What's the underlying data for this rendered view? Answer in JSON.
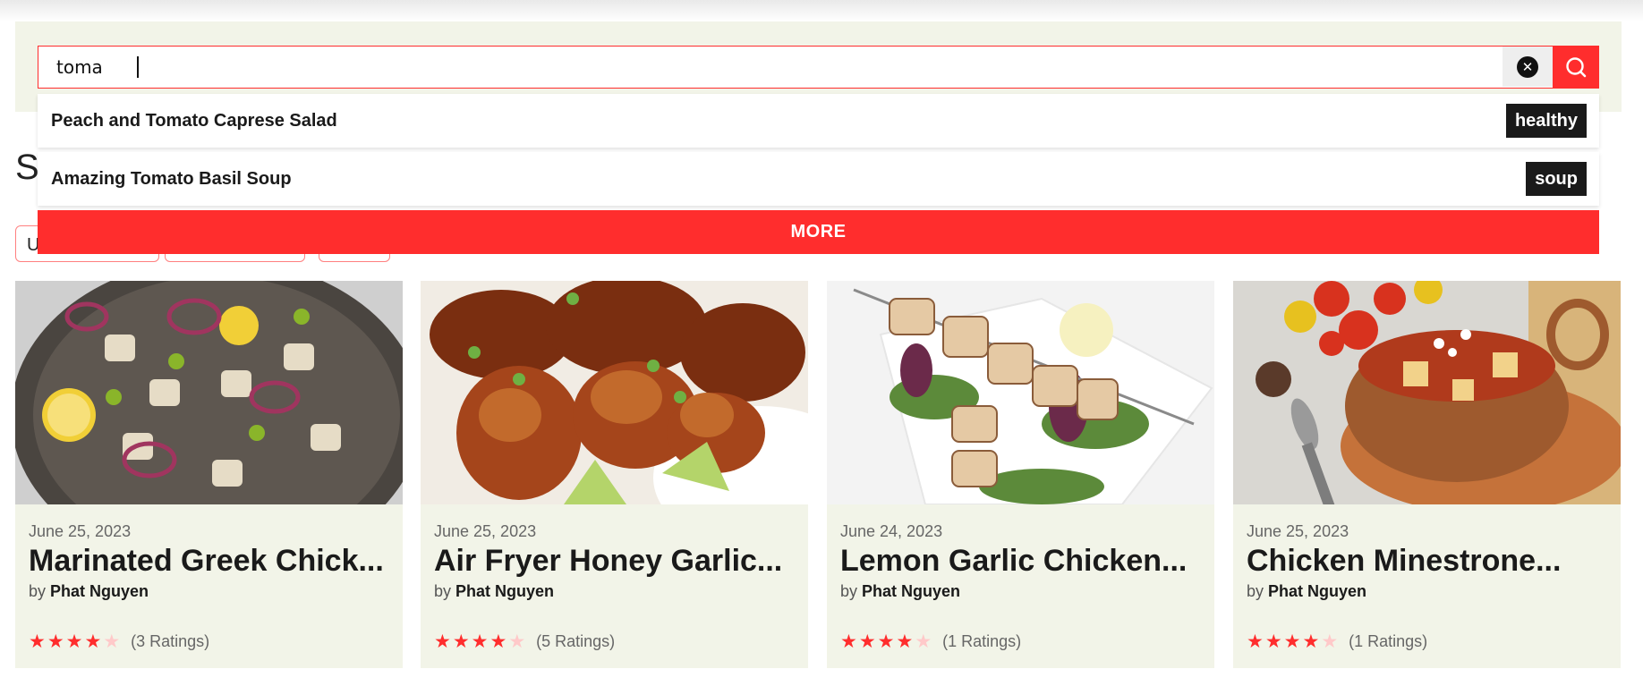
{
  "search": {
    "value": "toma",
    "clear_icon": "close-circle-icon",
    "submit_icon": "search-icon",
    "accent": "#ff2d2d"
  },
  "suggestions": [
    {
      "title": "Peach and Tomato Caprese Salad",
      "tag": "healthy"
    },
    {
      "title": "Amazing Tomato Basil Soup",
      "tag": "soup"
    }
  ],
  "more_label": "MORE",
  "background_heading_visible": "S",
  "background_chip_visible": "U",
  "cards": [
    {
      "date": "June 25, 2023",
      "title": "Marinated Greek Chick...",
      "by": "by",
      "author": "Phat Nguyen",
      "stars": 4,
      "ratings": "(3 Ratings)"
    },
    {
      "date": "June 25, 2023",
      "title": "Air Fryer Honey Garlic...",
      "by": "by",
      "author": "Phat Nguyen",
      "stars": 4,
      "ratings": "(5 Ratings)"
    },
    {
      "date": "June 24, 2023",
      "title": "Lemon Garlic Chicken...",
      "by": "by",
      "author": "Phat Nguyen",
      "stars": 4,
      "ratings": "(1 Ratings)"
    },
    {
      "date": "June 25, 2023",
      "title": "Chicken Minestrone...",
      "by": "by",
      "author": "Phat Nguyen",
      "stars": 4,
      "ratings": "(1 Ratings)"
    }
  ]
}
